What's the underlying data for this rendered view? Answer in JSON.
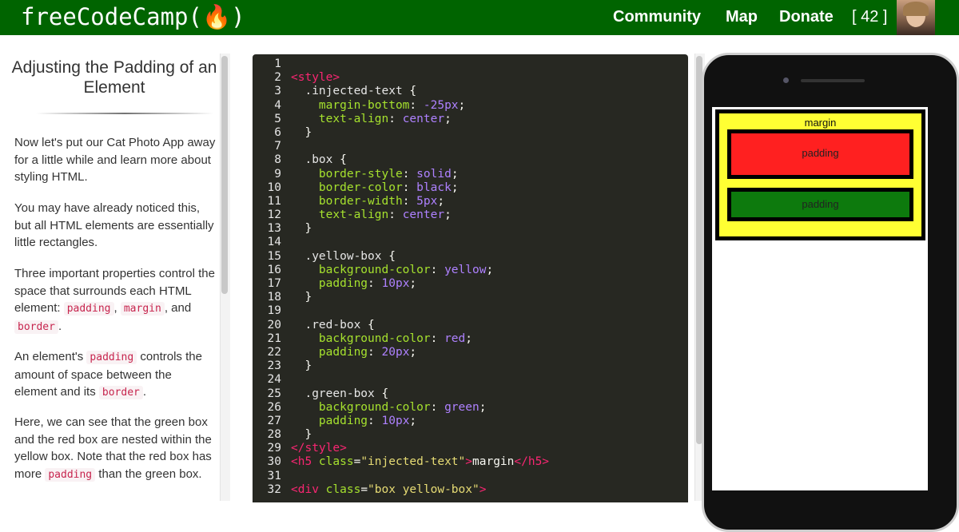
{
  "navbar": {
    "brand": "freeCodeCamp(🔥)",
    "links": [
      "Community",
      "Map",
      "Donate",
      "[ 42 ]"
    ]
  },
  "lesson": {
    "title": "Adjusting the Padding of an Element",
    "p1": "Now let's put our Cat Photo App away for a little while and learn more about styling HTML.",
    "p2": "You may have already noticed this, but all HTML elements are essentially little rectangles.",
    "p3_a": "Three important properties control the space that surrounds each HTML element: ",
    "p3_code1": "padding",
    "p3_b": ", ",
    "p3_code2": "margin",
    "p3_c": ", and ",
    "p3_code3": "border",
    "p3_d": ".",
    "p4_a": "An element's ",
    "p4_code1": "padding",
    "p4_b": " controls the amount of space between the element and its ",
    "p4_code2": "border",
    "p4_c": ".",
    "p5_a": "Here, we can see that the green box and the red box are nested within the yellow box. Note that the red box has more ",
    "p5_code": "padding",
    "p5_b": " than the green box."
  },
  "editor": {
    "lines": [
      [],
      [
        [
          "tag",
          "<style>"
        ]
      ],
      [
        [
          "sel",
          "  .injected-text "
        ],
        [
          "pun",
          "{"
        ]
      ],
      [
        [
          "prop",
          "    margin-bottom"
        ],
        [
          "pun",
          ": "
        ],
        [
          "val",
          "-25px"
        ],
        [
          "pun",
          ";"
        ]
      ],
      [
        [
          "prop",
          "    text-align"
        ],
        [
          "pun",
          ": "
        ],
        [
          "val",
          "center"
        ],
        [
          "pun",
          ";"
        ]
      ],
      [
        [
          "pun",
          "  }"
        ]
      ],
      [],
      [
        [
          "sel",
          "  .box "
        ],
        [
          "pun",
          "{"
        ]
      ],
      [
        [
          "prop",
          "    border-style"
        ],
        [
          "pun",
          ": "
        ],
        [
          "val",
          "solid"
        ],
        [
          "pun",
          ";"
        ]
      ],
      [
        [
          "prop",
          "    border-color"
        ],
        [
          "pun",
          ": "
        ],
        [
          "val",
          "black"
        ],
        [
          "pun",
          ";"
        ]
      ],
      [
        [
          "prop",
          "    border-width"
        ],
        [
          "pun",
          ": "
        ],
        [
          "val",
          "5px"
        ],
        [
          "pun",
          ";"
        ]
      ],
      [
        [
          "prop",
          "    text-align"
        ],
        [
          "pun",
          ": "
        ],
        [
          "val",
          "center"
        ],
        [
          "pun",
          ";"
        ]
      ],
      [
        [
          "pun",
          "  }"
        ]
      ],
      [],
      [
        [
          "sel",
          "  .yellow-box "
        ],
        [
          "pun",
          "{"
        ]
      ],
      [
        [
          "prop",
          "    background-color"
        ],
        [
          "pun",
          ": "
        ],
        [
          "val",
          "yellow"
        ],
        [
          "pun",
          ";"
        ]
      ],
      [
        [
          "prop",
          "    padding"
        ],
        [
          "pun",
          ": "
        ],
        [
          "val",
          "10px"
        ],
        [
          "pun",
          ";"
        ]
      ],
      [
        [
          "pun",
          "  }"
        ]
      ],
      [],
      [
        [
          "sel",
          "  .red-box "
        ],
        [
          "pun",
          "{"
        ]
      ],
      [
        [
          "prop",
          "    background-color"
        ],
        [
          "pun",
          ": "
        ],
        [
          "val",
          "red"
        ],
        [
          "pun",
          ";"
        ]
      ],
      [
        [
          "prop",
          "    padding"
        ],
        [
          "pun",
          ": "
        ],
        [
          "val",
          "20px"
        ],
        [
          "pun",
          ";"
        ]
      ],
      [
        [
          "pun",
          "  }"
        ]
      ],
      [],
      [
        [
          "sel",
          "  .green-box "
        ],
        [
          "pun",
          "{"
        ]
      ],
      [
        [
          "prop",
          "    background-color"
        ],
        [
          "pun",
          ": "
        ],
        [
          "val",
          "green"
        ],
        [
          "pun",
          ";"
        ]
      ],
      [
        [
          "prop",
          "    padding"
        ],
        [
          "pun",
          ": "
        ],
        [
          "val",
          "10px"
        ],
        [
          "pun",
          ";"
        ]
      ],
      [
        [
          "pun",
          "  }"
        ]
      ],
      [
        [
          "tag",
          "</style>"
        ]
      ],
      [
        [
          "tag",
          "<h5 "
        ],
        [
          "prop",
          "class"
        ],
        [
          "pun",
          "="
        ],
        [
          "str",
          "\"injected-text\""
        ],
        [
          "tag",
          ">"
        ],
        [
          "txt",
          "margin"
        ],
        [
          "tag",
          "</h5>"
        ]
      ],
      [],
      [
        [
          "tag",
          "<div "
        ],
        [
          "prop",
          "class"
        ],
        [
          "pun",
          "="
        ],
        [
          "str",
          "\"box yellow-box\""
        ],
        [
          "tag",
          ">"
        ]
      ]
    ]
  },
  "preview": {
    "margin_label": "margin",
    "red_label": "padding",
    "green_label": "padding"
  },
  "colors": {
    "navbar": "#006400",
    "editor_bg": "#272822",
    "yellow_box": "#ffff33",
    "red_box": "#ff2020",
    "green_box": "#0d7a0d"
  }
}
